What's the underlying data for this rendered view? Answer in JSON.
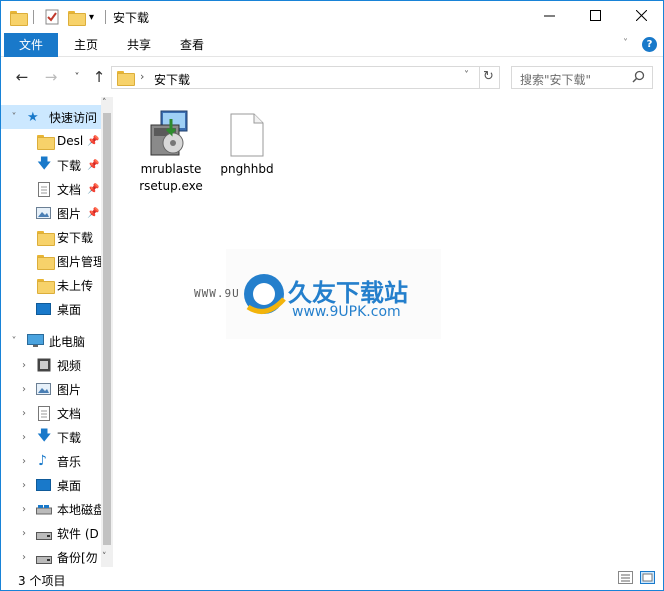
{
  "window": {
    "title": "安下载",
    "minimize_glyph": "—",
    "maximize_glyph": "☐",
    "close_glyph": "✕"
  },
  "ribbon": {
    "tabs": [
      {
        "label": "文件",
        "active": true
      },
      {
        "label": "主页"
      },
      {
        "label": "共享"
      },
      {
        "label": "查看"
      }
    ]
  },
  "address": {
    "path": "安下载",
    "search_placeholder": "搜索\"安下载\""
  },
  "nav": {
    "items": [
      {
        "label": "快速访问",
        "icon": "star-icon",
        "level": 0,
        "expanded": true,
        "selected": true
      },
      {
        "label": "Desl",
        "icon": "folder-icon",
        "level": 1,
        "pinned": true
      },
      {
        "label": "下载",
        "icon": "download-arrow-icon",
        "level": 1,
        "pinned": true
      },
      {
        "label": "文档",
        "icon": "document-icon",
        "level": 1,
        "pinned": true
      },
      {
        "label": "图片",
        "icon": "picture-icon",
        "level": 1,
        "pinned": true
      },
      {
        "label": "安下载",
        "icon": "folder-icon",
        "level": 1
      },
      {
        "label": "图片管理",
        "icon": "folder-icon",
        "level": 1
      },
      {
        "label": "未上传",
        "icon": "folder-icon",
        "level": 1
      },
      {
        "label": "桌面",
        "icon": "desktop-icon",
        "level": 1
      },
      {
        "label": "此电脑",
        "icon": "computer-icon",
        "level": 0,
        "expanded": true
      },
      {
        "label": "视频",
        "icon": "video-icon",
        "level": 1
      },
      {
        "label": "图片",
        "icon": "picture-icon",
        "level": 1
      },
      {
        "label": "文档",
        "icon": "document-icon",
        "level": 1
      },
      {
        "label": "下载",
        "icon": "download-arrow-icon",
        "level": 1
      },
      {
        "label": "音乐",
        "icon": "music-icon",
        "level": 1
      },
      {
        "label": "桌面",
        "icon": "desktop-icon",
        "level": 1
      },
      {
        "label": "本地磁盘",
        "icon": "drive-icon",
        "level": 1
      },
      {
        "label": "软件 (D",
        "icon": "drive-icon",
        "level": 1
      },
      {
        "label": "备份[勿",
        "icon": "drive-icon",
        "level": 1
      }
    ]
  },
  "files": [
    {
      "name_line1": "mrublaste",
      "name_line2": "rsetup.exe",
      "icon": "installer-icon"
    },
    {
      "name_line1": "pnghhbd",
      "name_line2": "",
      "icon": "blank-file-icon"
    }
  ],
  "status": {
    "count": "3 个项目"
  },
  "watermark": {
    "brand": "久友下载站",
    "url": "www.9UPK.com",
    "url_left": "WWW.9U"
  },
  "colors": {
    "accent": "#1979ca",
    "selection": "#cce8ff"
  }
}
